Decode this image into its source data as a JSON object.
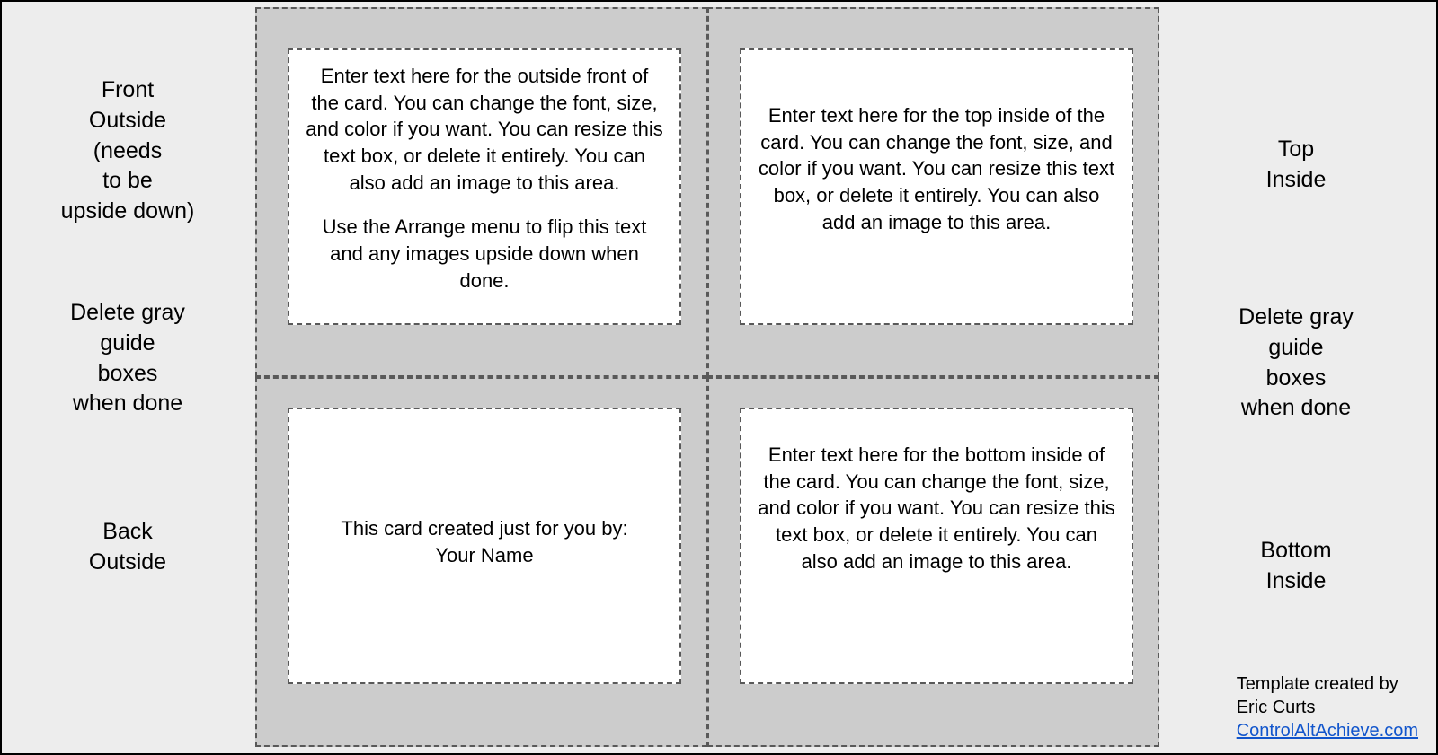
{
  "labels": {
    "front_outside": "Front\nOutside\n(needs\nto be\nupside down)",
    "delete_left": "Delete gray\nguide\nboxes\nwhen done",
    "back_outside": "Back\nOutside",
    "top_inside": "Top\nInside",
    "delete_right": "Delete gray\nguide\nboxes\nwhen done",
    "bottom_inside": "Bottom\nInside"
  },
  "panels": {
    "front_outside_p1": "Enter text here for the outside front of the card. You can change the font, size, and color if you want. You can resize this text box, or delete it entirely. You can also add an image to this area.",
    "front_outside_p2": "Use the Arrange menu to flip this text and any images upside down when done.",
    "top_inside": "Enter text here for the top inside of the card. You can change the font, size, and color if you want. You can resize this text box, or delete it entirely. You can also add an image to this area.",
    "back_outside": "This card created just for you by:\nYour Name",
    "bottom_inside": "Enter text here for the bottom inside of the card. You can change the font, size, and color if you want. You can resize this text box, or delete it entirely. You can also add an image to this area."
  },
  "credit": {
    "line1": "Template created by",
    "line2": "Eric Curts",
    "link": "ControlAltAchieve.com"
  }
}
